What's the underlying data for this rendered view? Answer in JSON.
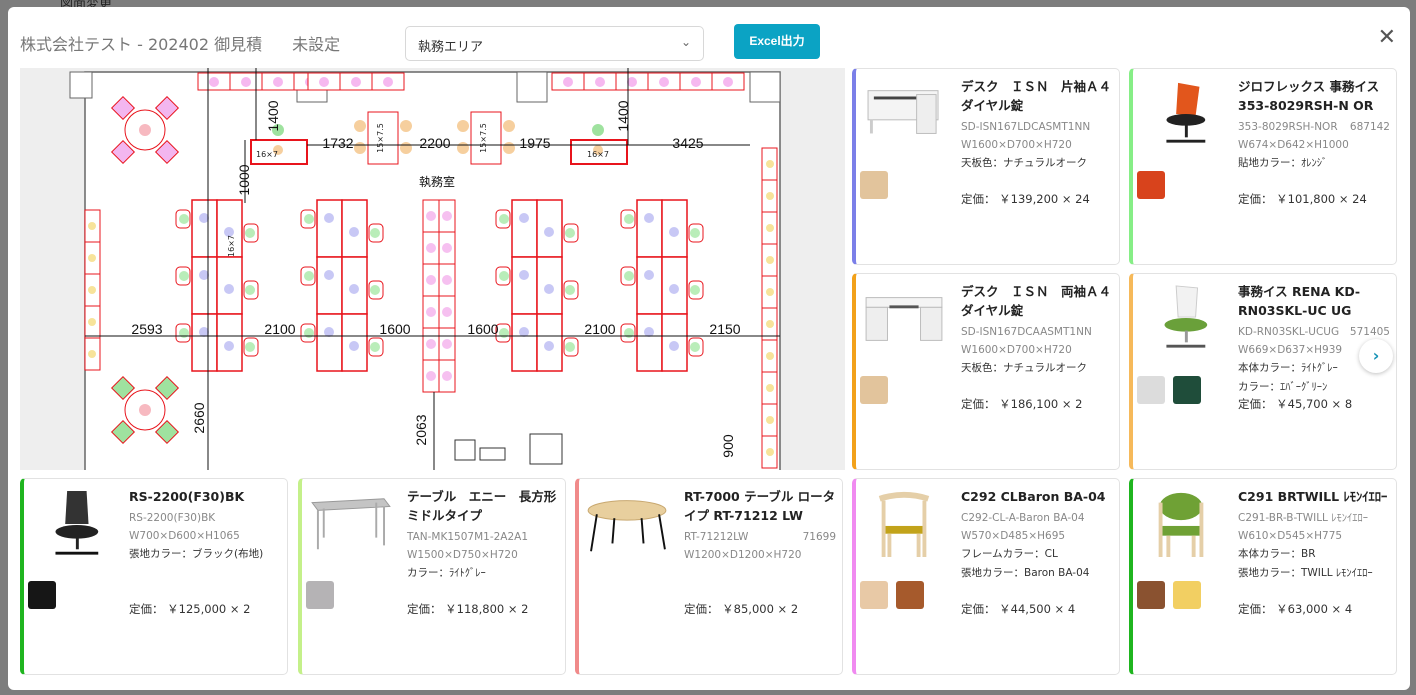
{
  "background": {
    "tab_label": "図面変更"
  },
  "header": {
    "title": "株式会社テスト - 202402 御見積",
    "status": "未設定",
    "area_select": "執務エリア",
    "excel_button": "Excel出力"
  },
  "floor_plan": {
    "room_label": "執務室",
    "dimensions": [
      "1400",
      "1000",
      "1732",
      "2200",
      "1975",
      "1400",
      "3425",
      "2593",
      "2100",
      "1600",
      "1600",
      "2100",
      "2150",
      "2660",
      "2063",
      "900"
    ],
    "desk_labels": [
      "16×7",
      "16×7",
      "15×7.5",
      "15×7.5",
      "16×7"
    ]
  },
  "cards": [
    {
      "title": "デスク　ＩＳＮ　片袖Ａ４ダイヤル錠",
      "code": "SD-ISN167LDCASMT1NN",
      "num": "",
      "dims": "W1600×D700×H720",
      "attrs": [
        "天板色：ナチュラルオーク"
      ],
      "price": "定価： ￥139,200 × 24",
      "accent": "#7b7fe8",
      "image": "desk-single",
      "swatches": [
        "#e2c49c"
      ]
    },
    {
      "title": "ジロフレックス 事務イス 353-8029RSH-N OR",
      "code": "353-8029RSH-NOR",
      "num": "687142",
      "dims": "W674×D642×H1000",
      "attrs": [
        "貼地カラー：ｵﾚﾝｼﾞ"
      ],
      "price": "定価： ￥101,800 × 24",
      "accent": "#86ee86",
      "image": "chair-orange",
      "swatches": [
        "#d8431c"
      ]
    },
    {
      "title": "デスク　ＩＳＮ　両袖Ａ４ダイヤル錠",
      "code": "SD-ISN167DCAASMT1NN",
      "num": "",
      "dims": "W1600×D700×H720",
      "attrs": [
        "天板色：ナチュラルオーク"
      ],
      "price": "定価： ￥186,100 × 2",
      "accent": "#f2a11a",
      "image": "desk-double",
      "swatches": [
        "#e2c49c"
      ]
    },
    {
      "title": "事務イス RENA KD-RN03SKL-UC UG",
      "code": "KD-RN03SKL-UCUG",
      "num": "571405",
      "dims": "W669×D637×H939",
      "attrs": [
        "本体カラー：ﾗｲﾄｸﾞﾚｰ",
        "カラー：ｴﾊﾞｰｸﾞﾘｰﾝ"
      ],
      "price": "定価： ￥45,700 × 8",
      "accent": "#f6b95a",
      "image": "chair-green",
      "swatches": [
        "#dcdcdc",
        "#1f4d3a"
      ]
    },
    {
      "title": "RS-2200(F30)BK",
      "code": "RS-2200(F30)BK",
      "num": "",
      "dims": "W700×D600×H1065",
      "attrs": [
        "張地カラー：ブラック(布地)"
      ],
      "price": "定価： ￥125,000 × 2",
      "accent": "#1fb51f",
      "image": "chair-black",
      "swatches": [
        "#161616"
      ]
    },
    {
      "title": "テーブル　エニー　長方形　ミドルタイプ",
      "code": "TAN-MK1507M1-2A2A1",
      "num": "",
      "dims": "W1500×D750×H720",
      "attrs": [
        "カラー：ﾗｲﾄｸﾞﾚｰ"
      ],
      "price": "定価： ￥118,800 × 2",
      "accent": "#c4f08a",
      "image": "table-rect",
      "swatches": [
        "#b5b3b5"
      ]
    },
    {
      "title": "RT-7000 テーブル ロータイプ RT-71212 LW",
      "code": "RT-71212LW",
      "num": "71699",
      "dims": "W1200×D1200×H720",
      "attrs": [],
      "price": "定価： ￥85,000 × 2",
      "accent": "#f08a8a",
      "image": "table-round",
      "swatches": []
    },
    {
      "title": "C292 CLBaron BA-04",
      "code": "C292-CL-A-Baron BA-04",
      "num": "",
      "dims": "W570×D485×H695",
      "attrs": [
        "フレームカラー：CL",
        "張地カラー：Baron BA-04"
      ],
      "price": "定価： ￥44,500 × 4",
      "accent": "#f08af0",
      "image": "wood-chair-yellow",
      "swatches": [
        "#e8c9a6",
        "#a65a2c"
      ]
    },
    {
      "title": "C291 BRTWILL ﾚﾓﾝｲｴﾛｰ",
      "code": "C291-BR-B-TWILL ﾚﾓﾝｲｴﾛｰ",
      "num": "",
      "dims": "W610×D545×H775",
      "attrs": [
        "本体カラー：BR",
        "張地カラー：TWILL ﾚﾓﾝｲｴﾛｰ"
      ],
      "price": "定価： ￥63,000 × 4",
      "accent": "#1fb51f",
      "image": "wood-chair-green",
      "swatches": [
        "#8a5230",
        "#f2cf62"
      ]
    }
  ],
  "colors": {
    "accent": "#0ba3c4"
  }
}
